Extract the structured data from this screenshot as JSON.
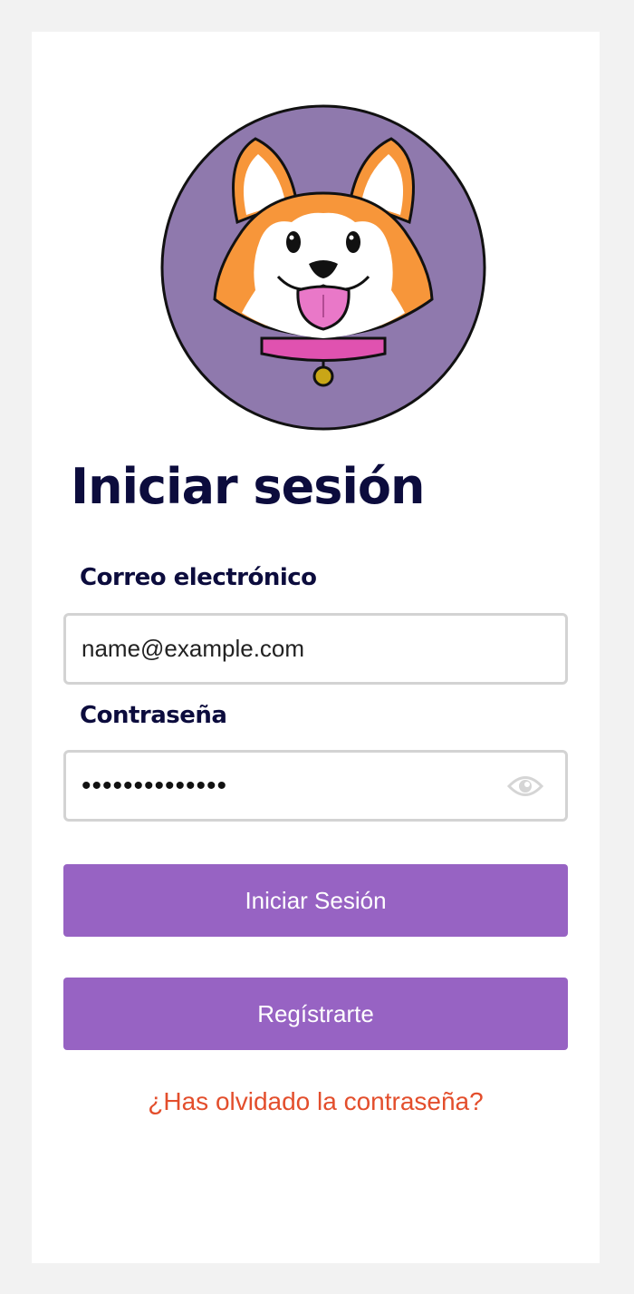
{
  "login": {
    "title": "Iniciar sesión",
    "email_label": "Correo electrónico",
    "email_value": "name@example.com",
    "password_label": "Contraseña",
    "password_value": "••••••••••••••",
    "login_button": "Iniciar Sesión",
    "register_button": "Regístrarte",
    "forgot_link": "¿Has olvidado la contraseña?"
  },
  "icons": {
    "logo": "corgi-dog-logo",
    "password_toggle": "eye-icon"
  },
  "colors": {
    "background": "#f2f2f2",
    "card": "#ffffff",
    "heading": "#0c0c3d",
    "button": "#9763c3",
    "link": "#e34e2c",
    "logo_circle": "#8f79ad",
    "field_border": "#d3d3d3"
  }
}
